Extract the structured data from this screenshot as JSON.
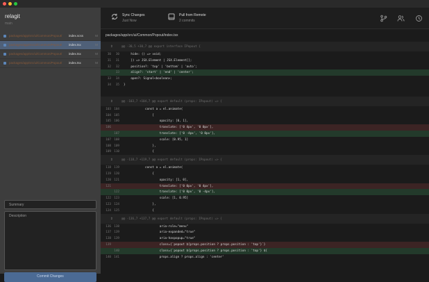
{
  "window": {
    "dots": [
      "#ff5f57",
      "#febc2e",
      "#28c840"
    ]
  },
  "sidebar": {
    "repo_name": "relagit",
    "branch": "main",
    "files": [
      {
        "path": "packages/app/src/ui/Common/Popout/",
        "name": "index.scss",
        "mark": "M",
        "selected": false
      },
      {
        "path": "packages/app/src/ui/Common/Popout/",
        "name": "index.tsx",
        "mark": "M",
        "selected": true
      },
      {
        "path": "packages/app/src/ui/Common/Popout/",
        "name": "index.tsx",
        "mark": "M",
        "selected": false
      },
      {
        "path": "packages/app/src/ui/Common/Popout/",
        "name": "index.tsx",
        "mark": "M",
        "selected": false
      }
    ],
    "summary_placeholder": "Summary",
    "description_placeholder": "Description",
    "commit_label": "Commit Changes"
  },
  "toolbar": {
    "sync_title": "Sync Changes",
    "sync_sub": "Just Now",
    "pull_title": "Pull from Remote",
    "pull_sub": "2 commits"
  },
  "diff": {
    "file_path": "packages/app/src/ui/Common/Popout/index.tsx",
    "blocks": [
      {
        "type": "hunk",
        "text": "@@ -30,5 +30,7 @@ export interface IPopout {"
      },
      {
        "type": "line",
        "kind": "ctx",
        "old": "30",
        "new": "30",
        "code": "    hide: () => void;"
      },
      {
        "type": "line",
        "kind": "ctx",
        "old": "31",
        "new": "31",
        "code": "    }) => JSX.Element | JSX.Element[];"
      },
      {
        "type": "line",
        "kind": "ctx",
        "old": "32",
        "new": "32",
        "code": "    position?: 'top' | 'bottom' | 'auto';"
      },
      {
        "type": "line",
        "kind": "add",
        "old": "",
        "new": "33",
        "code": "    align?: 'start' | 'end' | 'center';"
      },
      {
        "type": "line",
        "kind": "ctx",
        "old": "33",
        "new": "34",
        "code": "    open?: Signal<boolean>;"
      },
      {
        "type": "line",
        "kind": "ctx",
        "old": "34",
        "new": "35",
        "code": "}"
      },
      {
        "type": "gap"
      },
      {
        "type": "hunk",
        "text": "@@ -103,7 +104,7 @@ export default (props: IPopout) => {"
      },
      {
        "type": "line",
        "kind": "ctx",
        "old": "103",
        "new": "104",
        "code": "            const a = el.animate("
      },
      {
        "type": "line",
        "kind": "ctx",
        "old": "104",
        "new": "105",
        "code": "                ["
      },
      {
        "type": "line",
        "kind": "ctx",
        "old": "105",
        "new": "106",
        "code": "                    opacity: [0, 1],"
      },
      {
        "type": "line",
        "kind": "del",
        "old": "106",
        "new": "",
        "code": "                    translate: ['0 4px', '0 0px'],"
      },
      {
        "type": "line",
        "kind": "add",
        "old": "",
        "new": "107",
        "code": "                    translate: ['0 -4px', '0 0px'],"
      },
      {
        "type": "line",
        "kind": "ctx",
        "old": "107",
        "new": "108",
        "code": "                    scale: [0.95, 1]"
      },
      {
        "type": "line",
        "kind": "ctx",
        "old": "108",
        "new": "109",
        "code": "                },"
      },
      {
        "type": "line",
        "kind": "ctx",
        "old": "109",
        "new": "110",
        "code": "                {"
      },
      {
        "type": "hunk",
        "text": "@@ -118,7 +119,7 @@ export default (props: IPopout) => {"
      },
      {
        "type": "line",
        "kind": "ctx",
        "old": "118",
        "new": "119",
        "code": "            const a = el.animate("
      },
      {
        "type": "line",
        "kind": "ctx",
        "old": "119",
        "new": "120",
        "code": "                {"
      },
      {
        "type": "line",
        "kind": "ctx",
        "old": "120",
        "new": "121",
        "code": "                    opacity: [1, 0],"
      },
      {
        "type": "line",
        "kind": "del",
        "old": "121",
        "new": "",
        "code": "                    translate: ['0 0px', '0 4px'],"
      },
      {
        "type": "line",
        "kind": "add",
        "old": "",
        "new": "122",
        "code": "                    translate: ['0 0px', '0 -4px'],"
      },
      {
        "type": "line",
        "kind": "ctx",
        "old": "122",
        "new": "123",
        "code": "                    scale: [1, 0.95]"
      },
      {
        "type": "line",
        "kind": "ctx",
        "old": "123",
        "new": "124",
        "code": "                },"
      },
      {
        "type": "line",
        "kind": "ctx",
        "old": "124",
        "new": "125",
        "code": "                {"
      },
      {
        "type": "hunk",
        "text": "@@ -136,7 +137,7 @@ export default (props: IPopout) => {"
      },
      {
        "type": "line",
        "kind": "ctx",
        "old": "136",
        "new": "138",
        "code": "                    aria-role=\"menu\""
      },
      {
        "type": "line",
        "kind": "ctx",
        "old": "137",
        "new": "139",
        "code": "                    aria-expanded=\"true\""
      },
      {
        "type": "line",
        "kind": "ctx",
        "old": "138",
        "new": "139",
        "code": "                    aria-haspopup=\"true\""
      },
      {
        "type": "line",
        "kind": "del",
        "old": "139",
        "new": "",
        "code": "                    class={`popout ${props.position ? props.position : 'top'}`}"
      },
      {
        "type": "line",
        "kind": "add",
        "old": "",
        "new": "140",
        "code": "                    class={`popout ${props.position ? props.position : 'top'} ${"
      },
      {
        "type": "line",
        "kind": "ctx",
        "old": "140",
        "new": "141",
        "code": "                    props.align ? props.align : 'center'"
      }
    ]
  }
}
